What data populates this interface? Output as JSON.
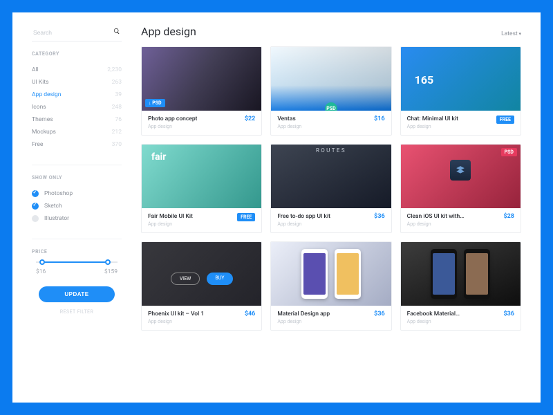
{
  "search": {
    "placeholder": "Search"
  },
  "sidebar": {
    "category_heading": "CATEGORY",
    "categories": [
      {
        "label": "All",
        "count": "2,230"
      },
      {
        "label": "UI Kits",
        "count": "263"
      },
      {
        "label": "App design",
        "count": "39"
      },
      {
        "label": "Icons",
        "count": "248"
      },
      {
        "label": "Themes",
        "count": "76"
      },
      {
        "label": "Mockups",
        "count": "212"
      },
      {
        "label": "Free",
        "count": "370"
      }
    ],
    "show_only_heading": "SHOW ONLY",
    "filters": [
      {
        "label": "Photoshop",
        "checked": true
      },
      {
        "label": "Sketch",
        "checked": true
      },
      {
        "label": "Illustrator",
        "checked": false
      }
    ],
    "price_heading": "PRICE",
    "price_min": "$16",
    "price_max": "$159",
    "update_label": "UPDATE",
    "reset_label": "RESET FILTER"
  },
  "main": {
    "title": "App design",
    "sort_label": "Latest"
  },
  "decor": {
    "psd_flag": "↓ PSD",
    "psd_tag": "PSD",
    "psd_small": "PSD",
    "fair": "fair",
    "routes": "ROUTES",
    "chat_num": "165",
    "view": "VIEW",
    "buy": "BUY"
  },
  "items": [
    {
      "name": "Photo app concept",
      "cat": "App design",
      "price": "$22",
      "free": false
    },
    {
      "name": "Ventas",
      "cat": "App design",
      "price": "$16",
      "free": false
    },
    {
      "name": "Chat: Minimal UI kit",
      "cat": "App design",
      "price": "",
      "free": true
    },
    {
      "name": "Fair Mobile UI Kit",
      "cat": "App design",
      "price": "",
      "free": true
    },
    {
      "name": "Free to-do app UI kit",
      "cat": "App design",
      "price": "$36",
      "free": false
    },
    {
      "name": "Clean iOS UI kit with…",
      "cat": "App design",
      "price": "$28",
      "free": false
    },
    {
      "name": "Phoenix UI kit – Vol 1",
      "cat": "App design",
      "price": "$46",
      "free": false
    },
    {
      "name": "Material Design app",
      "cat": "App design",
      "price": "$36",
      "free": false
    },
    {
      "name": "Facebook Material…",
      "cat": "App design",
      "price": "$36",
      "free": false
    }
  ],
  "free_label": "FREE"
}
